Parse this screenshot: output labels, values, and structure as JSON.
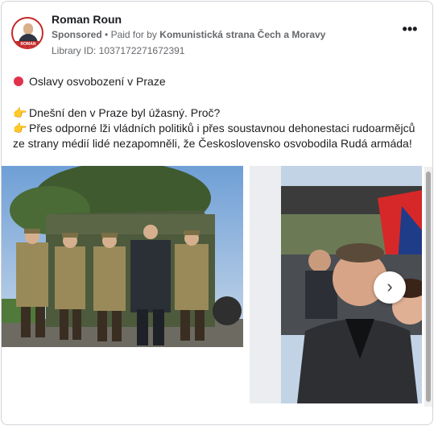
{
  "advertiser": {
    "name": "Roman Roun",
    "sponsored_label": "Sponsored",
    "paid_for_prefix": "Paid for by",
    "paid_for_by": "Komunistická strana Čech a Moravy",
    "library_id": "Library ID: 1037172271672391",
    "avatar_caption": "ROMAN ROUN"
  },
  "menu": {
    "more_label": "•••"
  },
  "post": {
    "line1": "Oslavy osvobození v Praze",
    "line2": "Dnešní den v Praze byl úžasný. Proč?",
    "line3": "Přes odporné lži vládních politiků i přes soustavnou dehonestaci rudoarmějců ze strany médií lidé nezapomněli, že Československo osvobodila Rudá armáda!"
  },
  "icons": [
    "red-circle-icon",
    "pointing-hand-icon",
    "more-options-icon",
    "chevron-right-icon"
  ],
  "colors": {
    "red_dot": "#e0334b",
    "hand": "#f4b400",
    "meta_text": "#65676b"
  },
  "carousel": {
    "next_label": "›"
  }
}
